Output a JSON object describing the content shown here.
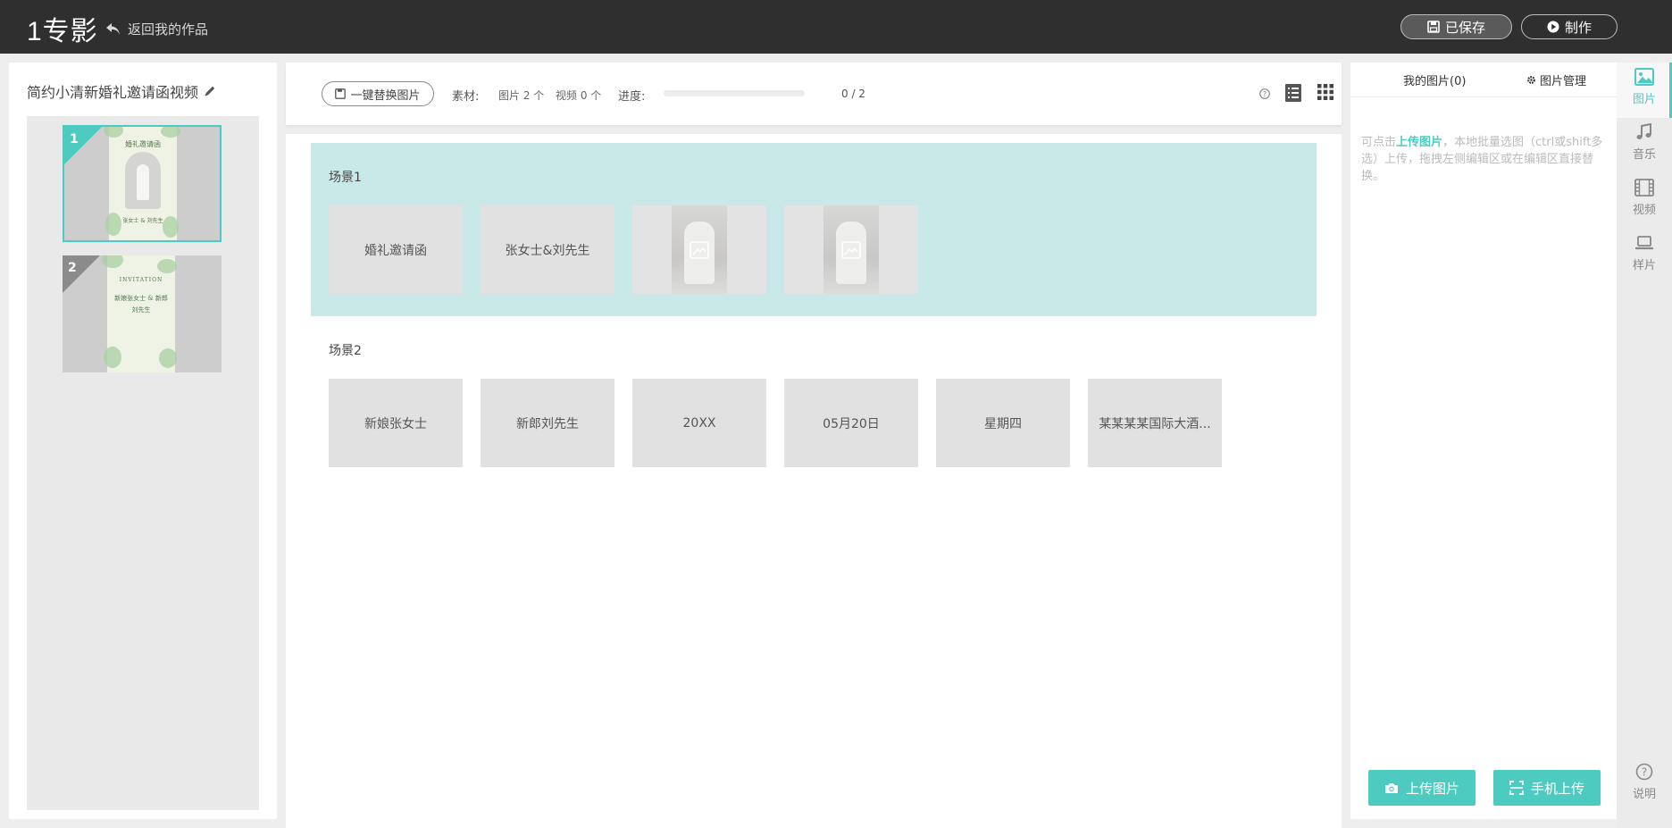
{
  "app": {
    "logo": "1专影",
    "back_label": "返回我的作品"
  },
  "header": {
    "saved_label": "已保存",
    "make_label": "制作"
  },
  "work": {
    "title": "简约小清新婚礼邀请函视频",
    "pages": [
      {
        "num": "1",
        "card_title": "婚礼邀请函",
        "card_caption": "张女士 & 刘先生"
      },
      {
        "num": "2",
        "card_title": "INVITATION",
        "card_caption": "新娘张女士 & 新郎刘先生"
      }
    ]
  },
  "toolbar": {
    "replace_label": "一键替换图片",
    "material_label": "素材:",
    "image_count": "图片 2 个",
    "video_count": "视频 0 个",
    "progress_label": "进度:",
    "progress_text": "0 / 2",
    "progress_value": 0
  },
  "scenes": [
    {
      "label": "场景1",
      "slots": [
        "婚礼邀请函",
        "张女士&刘先生",
        "",
        ""
      ]
    },
    {
      "label": "场景2",
      "slots": [
        "新娘张女士",
        "新郎刘先生",
        "20XX",
        "05月20日",
        "星期四",
        "某某某某国际大酒..."
      ]
    }
  ],
  "right_panel": {
    "tab_my_images": "我的图片(0)",
    "tab_manage": "图片管理",
    "hint_prefix": "可点击",
    "hint_link": "上传图片",
    "hint_suffix": "，本地批量选图（ctrl或shift多选）上传，拖拽左侧编辑区或在编辑区直接替换。",
    "upload_label": "上传图片",
    "mobile_upload_label": "手机上传"
  },
  "sidenav": {
    "items": [
      {
        "label": "图片",
        "icon": "image-icon",
        "active": true
      },
      {
        "label": "音乐",
        "icon": "music-icon"
      },
      {
        "label": "视频",
        "icon": "film-icon"
      },
      {
        "label": "样片",
        "icon": "laptop-icon"
      }
    ],
    "help_label": "说明"
  },
  "colors": {
    "accent": "#4ecbc0",
    "topbar": "#2f2f2f",
    "scene_highlight": "#c9e9e8"
  }
}
